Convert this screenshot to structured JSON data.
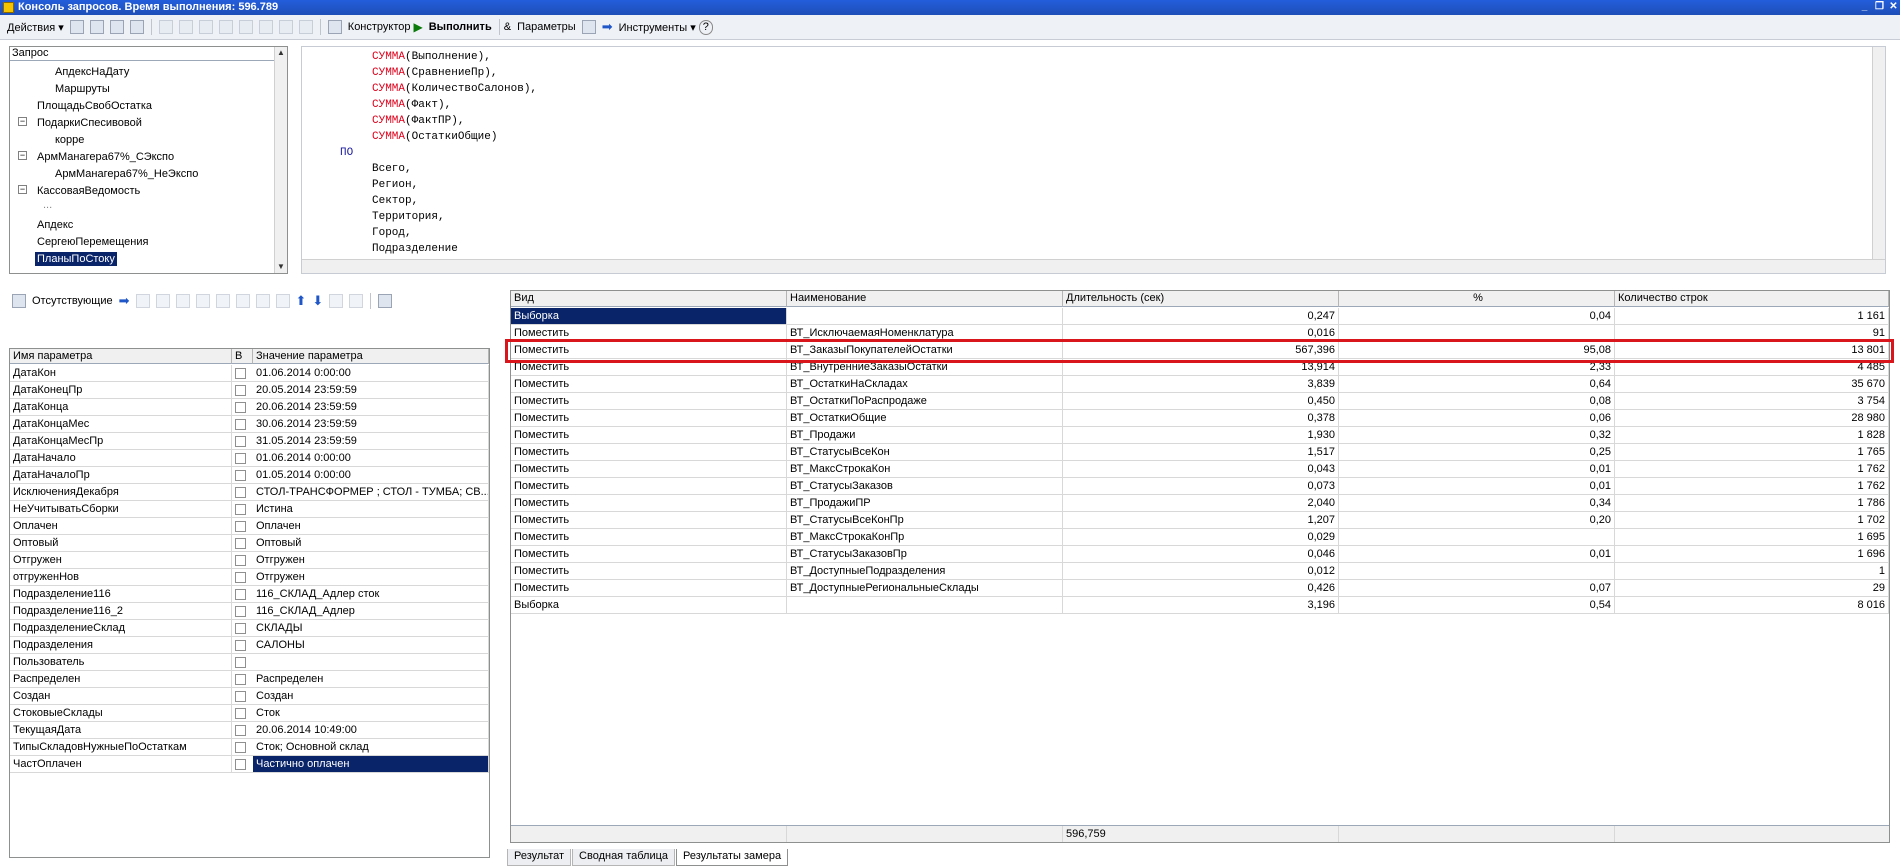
{
  "window": {
    "title": "Консоль запросов. Время выполнения: 596.789",
    "controls": [
      "_",
      "❐",
      "✕"
    ]
  },
  "toolbar": {
    "actions_label": "Действия ▾",
    "constructor_label": "Конструктор",
    "execute_label": "Выполнить",
    "params_label": "Параметры",
    "tools_label": "Инструменты ▾",
    "help_label": "?"
  },
  "tree": {
    "header": "Запрос",
    "nodes": [
      {
        "label": "АпдексНаДату"
      },
      {
        "label": "Маршруты"
      },
      {
        "label": "ПлощадьСвобОстатка"
      },
      {
        "label": "ПодаркиСпесивовой"
      },
      {
        "label": "корре"
      },
      {
        "label": "АрмМанагера67%_СЭкспо"
      },
      {
        "label": "АрмМанагера67%_НеЭкспо"
      },
      {
        "label": "КассоваяВедомость"
      },
      {
        "label": "..."
      },
      {
        "label": "Апдекс"
      },
      {
        "label": "СергеюПеремещения"
      },
      {
        "label": "ПланыПоСтоку"
      }
    ]
  },
  "editor": {
    "lines": [
      {
        "kw": "СУММА",
        "rest": "(Выполнение),"
      },
      {
        "kw": "СУММА",
        "rest": "(СравнениеПр),"
      },
      {
        "kw": "СУММА",
        "rest": "(КоличествоСалонов),"
      },
      {
        "kw": "СУММА",
        "rest": "(Факт),"
      },
      {
        "kw": "СУММА",
        "rest": "(ФактПР),"
      },
      {
        "kw": "СУММА",
        "rest": "(ОстаткиОбщие)"
      },
      {
        "kw": "ПО",
        "rest": ""
      },
      {
        "kw": "",
        "rest": "Всего,"
      },
      {
        "kw": "",
        "rest": "Регион,"
      },
      {
        "kw": "",
        "rest": "Сектор,"
      },
      {
        "kw": "",
        "rest": "Территория,"
      },
      {
        "kw": "",
        "rest": "Город,"
      },
      {
        "kw": "",
        "rest": "Подразделение"
      }
    ]
  },
  "params_toolbar": {
    "missing_label": "Отсутствующие"
  },
  "params_table": {
    "headers": [
      "Имя параметра",
      "В",
      "Значение параметра"
    ],
    "rows": [
      {
        "name": "ДатаКон",
        "value": "01.06.2014 0:00:00"
      },
      {
        "name": "ДатаКонецПр",
        "value": "20.05.2014 23:59:59"
      },
      {
        "name": "ДатаКонца",
        "value": "20.06.2014 23:59:59"
      },
      {
        "name": "ДатаКонцаМес",
        "value": "30.06.2014 23:59:59"
      },
      {
        "name": "ДатаКонцаМесПр",
        "value": "31.05.2014 23:59:59"
      },
      {
        "name": "ДатаНачало",
        "value": "01.06.2014 0:00:00"
      },
      {
        "name": "ДатаНачалоПр",
        "value": "01.05.2014 0:00:00"
      },
      {
        "name": "ИсключенияДекабря",
        "value": "СТОЛ-ТРАНСФОРМЕР ; СТОЛ - ТУМБА; СВ..."
      },
      {
        "name": "НеУчитыватьСборки",
        "value": "Истина"
      },
      {
        "name": "Оплачен",
        "value": "Оплачен"
      },
      {
        "name": "Оптовый",
        "value": "Оптовый"
      },
      {
        "name": "Отгружен",
        "value": "Отгружен"
      },
      {
        "name": "отгруженНов",
        "value": "Отгружен"
      },
      {
        "name": "Подразделение116",
        "value": "116_СКЛАД_Адлер сток"
      },
      {
        "name": "Подразделение116_2",
        "value": "116_СКЛАД_Адлер"
      },
      {
        "name": "ПодразделениеСклад",
        "value": " СКЛАДЫ"
      },
      {
        "name": "Подразделения",
        "value": "САЛОНЫ"
      },
      {
        "name": "Пользователь",
        "value": ""
      },
      {
        "name": "Распределен",
        "value": "Распределен"
      },
      {
        "name": "Создан",
        "value": "Создан"
      },
      {
        "name": "СтоковыеСклады",
        "value": "Сток"
      },
      {
        "name": "ТекущаяДата",
        "value": "20.06.2014 10:49:00"
      },
      {
        "name": "ТипыСкладовНужныеПоОстаткам",
        "value": "Сток; Основной склад"
      },
      {
        "name": "ЧастОплачен",
        "value": "Частично оплачен"
      }
    ]
  },
  "results_table": {
    "headers": [
      "Вид",
      "Наименование",
      "Длительность (сек)",
      "%",
      "Количество строк"
    ],
    "rows": [
      {
        "kind": "Выборка",
        "name": "",
        "duration": "0,247",
        "pct": "0,04",
        "count": "1 161"
      },
      {
        "kind": "Поместить",
        "name": "ВТ_ИсключаемаяНоменклатура",
        "duration": "0,016",
        "pct": "",
        "count": "91"
      },
      {
        "kind": "Поместить",
        "name": "ВТ_ЗаказыПокупателейОстатки",
        "duration": "567,396",
        "pct": "95,08",
        "count": "13 801"
      },
      {
        "kind": "Поместить",
        "name": "ВТ_ВнутренниеЗаказыОстатки",
        "duration": "13,914",
        "pct": "2,33",
        "count": "4 485"
      },
      {
        "kind": "Поместить",
        "name": "ВТ_ОстаткиНаСкладах",
        "duration": "3,839",
        "pct": "0,64",
        "count": "35 670"
      },
      {
        "kind": "Поместить",
        "name": "ВТ_ОстаткиПоРаспродаже",
        "duration": "0,450",
        "pct": "0,08",
        "count": "3 754"
      },
      {
        "kind": "Поместить",
        "name": "ВТ_ОстаткиОбщие",
        "duration": "0,378",
        "pct": "0,06",
        "count": "28 980"
      },
      {
        "kind": "Поместить",
        "name": "ВТ_Продажи",
        "duration": "1,930",
        "pct": "0,32",
        "count": "1 828"
      },
      {
        "kind": "Поместить",
        "name": "ВТ_СтатусыВсеКон",
        "duration": "1,517",
        "pct": "0,25",
        "count": "1 765"
      },
      {
        "kind": "Поместить",
        "name": "ВТ_МаксСтрокаКон",
        "duration": "0,043",
        "pct": "0,01",
        "count": "1 762"
      },
      {
        "kind": "Поместить",
        "name": "ВТ_СтатусыЗаказов",
        "duration": "0,073",
        "pct": "0,01",
        "count": "1 762"
      },
      {
        "kind": "Поместить",
        "name": "ВТ_ПродажиПР",
        "duration": "2,040",
        "pct": "0,34",
        "count": "1 786"
      },
      {
        "kind": "Поместить",
        "name": "ВТ_СтатусыВсеКонПр",
        "duration": "1,207",
        "pct": "0,20",
        "count": "1 702"
      },
      {
        "kind": "Поместить",
        "name": "ВТ_МаксСтрокаКонПр",
        "duration": "0,029",
        "pct": "",
        "count": "1 695"
      },
      {
        "kind": "Поместить",
        "name": "ВТ_СтатусыЗаказовПр",
        "duration": "0,046",
        "pct": "0,01",
        "count": "1 696"
      },
      {
        "kind": "Поместить",
        "name": "ВТ_ДоступныеПодразделения",
        "duration": "0,012",
        "pct": "",
        "count": "1"
      },
      {
        "kind": "Поместить",
        "name": "ВТ_ДоступныеРегиональныеСклады",
        "duration": "0,426",
        "pct": "0,07",
        "count": "29"
      },
      {
        "kind": "Выборка",
        "name": "",
        "duration": "3,196",
        "pct": "0,54",
        "count": "8 016"
      }
    ],
    "total_duration": "596,759"
  },
  "tabs": [
    "Результат",
    "Сводная таблица",
    "Результаты замера"
  ],
  "colors": {
    "selection": "#0a246a",
    "highlight_frame": "#d9161c",
    "keyword": "#e0001b"
  }
}
